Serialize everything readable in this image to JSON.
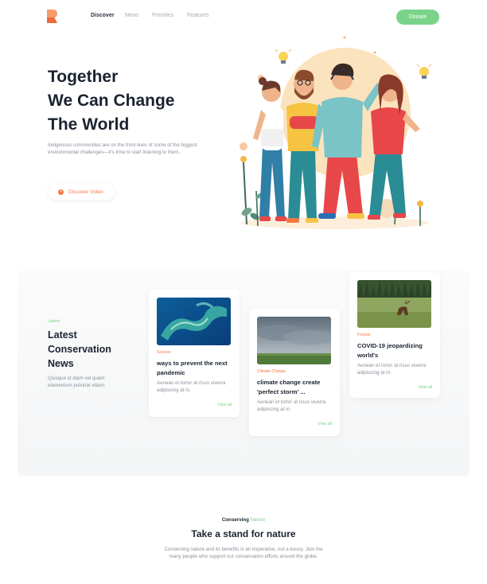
{
  "nav": {
    "items": [
      "Discover",
      "News",
      "Priorities",
      "Features"
    ],
    "donate_label": "Donate"
  },
  "hero": {
    "title_lines": [
      "Together",
      "We Can Change",
      "The World"
    ],
    "description": "Indigenous communities are on the front lines of some of the biggest environmental challenges—it's time to start listening to them.",
    "video_label": "Discover Video"
  },
  "news": {
    "kicker": "Latest",
    "heading_lines": [
      "Latest",
      "Conservation",
      "News"
    ],
    "description": "Quisque id diam vel quam elementum pulvinar etiam.",
    "cards": [
      {
        "tag": "Science",
        "title": "ways to prevent the next pandemic",
        "body": "Aenean et tortor at risus viverra adipiscing at in.",
        "link": "View all"
      },
      {
        "tag": "Climate Change",
        "title": "climate change create 'perfect storm' ...",
        "body": "Aenean et tortor at risus viverra adipiscing at in.",
        "link": "View all"
      },
      {
        "tag": "Forests",
        "title": "COVID-19 jeopardizing world's",
        "body": "Aenean et tortor at risus viverra adipiscing at in.",
        "link": "View all"
      }
    ]
  },
  "cta": {
    "kicker_main": "Conserving",
    "kicker_accent": "Nature",
    "title": "Take a stand for nature",
    "description": "Conserving nature and its benefits is an imperative, not a luxury. Join the many people who support our conservation efforts around the globe."
  },
  "colors": {
    "accent_green": "#7bd389",
    "accent_orange": "#f47a45",
    "text_dark": "#1a2330",
    "text_muted": "#8a929c"
  },
  "icons": [
    "logo-icon",
    "play-icon"
  ]
}
